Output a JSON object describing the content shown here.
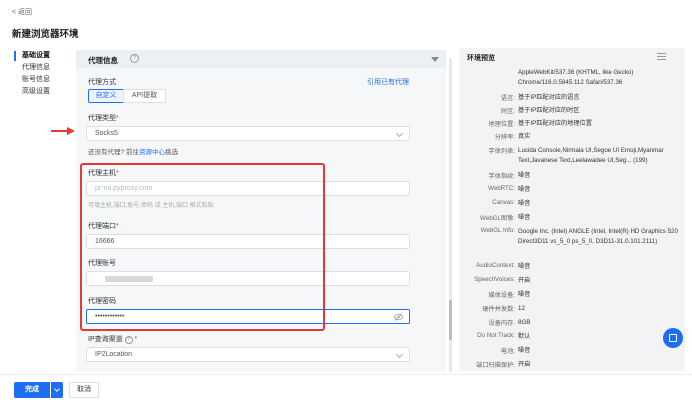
{
  "header": {
    "back": "< 返回",
    "title": "新建浏览器环境"
  },
  "nav": {
    "items": [
      "基础设置",
      "代理信息",
      "账号信息",
      "高级设置"
    ]
  },
  "form": {
    "section_title": "代理信息",
    "proxy_method": {
      "label": "代理方式",
      "options": [
        "自定义",
        "API提取"
      ],
      "use_existing": "引用已有代理"
    },
    "proxy_type": {
      "label": "代理类型",
      "value": "Socks5",
      "no_proxy_text": "还没有代理?",
      "go_text": "前往",
      "resource_center": "资源中心",
      "buy_text": "挑选"
    },
    "host": {
      "label": "代理主机",
      "placeholder": "pr-na.pyproxy.com",
      "hint": "可填主机,端口,账号,密码 或 主机,端口 格式粘贴"
    },
    "port": {
      "label": "代理端口",
      "value": "16666"
    },
    "account": {
      "label": "代理账号"
    },
    "password": {
      "label": "代理密码",
      "value": "••••••••••••"
    },
    "ip_channel": {
      "label": "IP查询渠道",
      "value": "IP2Location"
    }
  },
  "env": {
    "title": "环境预览",
    "rows": [
      {
        "key": "",
        "value": "AppleWebKit/537.36 (KHTML, like Gecko) Chrome/116.0.5845.112 Safari/537.36"
      },
      {
        "key": "语言:",
        "value": "基于IP匹配对应的语言"
      },
      {
        "key": "时区:",
        "value": "基于IP匹配对应的时区"
      },
      {
        "key": "地理位置:",
        "value": "基于IP匹配对应的地理位置"
      },
      {
        "key": "分辨率:",
        "value": "真实"
      },
      {
        "key": "字体列表:",
        "value": "Lucida Console,Nirmala UI,Segoe UI Emoji,Myanmar Text,Javanese Text,Leelawadee UI,Seg... (199)"
      },
      {
        "key": "字体指纹:",
        "value": "噪音"
      },
      {
        "key": "WebRTC:",
        "value": "噪音"
      },
      {
        "key": "Canvas:",
        "value": "噪音"
      },
      {
        "key": "WebGL图像:",
        "value": "噪音"
      },
      {
        "key": "WebGL Info:",
        "value": "Google Inc. (Intel) ANGLE (Intel, Intel(R) HD Graphics 520 Direct3D11 vs_5_0 ps_5_0, D3D11-31.0.101.2111)"
      },
      {
        "key": "AudioContext:",
        "value": "噪音"
      },
      {
        "key": "SpeechVoices:",
        "value": "开启"
      },
      {
        "key": "媒体设备:",
        "value": "噪音"
      },
      {
        "key": "硬件并发数:",
        "value": "12"
      },
      {
        "key": "设备内存:",
        "value": "8GB"
      },
      {
        "key": "Do Not Track:",
        "value": "默认"
      },
      {
        "key": "电池:",
        "value": "噪音"
      },
      {
        "key": "端口扫描保护:",
        "value": "开启"
      }
    ]
  },
  "footer": {
    "done": "完成",
    "cancel": "取消"
  },
  "colors": {
    "primary": "#1e6ef4",
    "highlight": "#e53935"
  }
}
